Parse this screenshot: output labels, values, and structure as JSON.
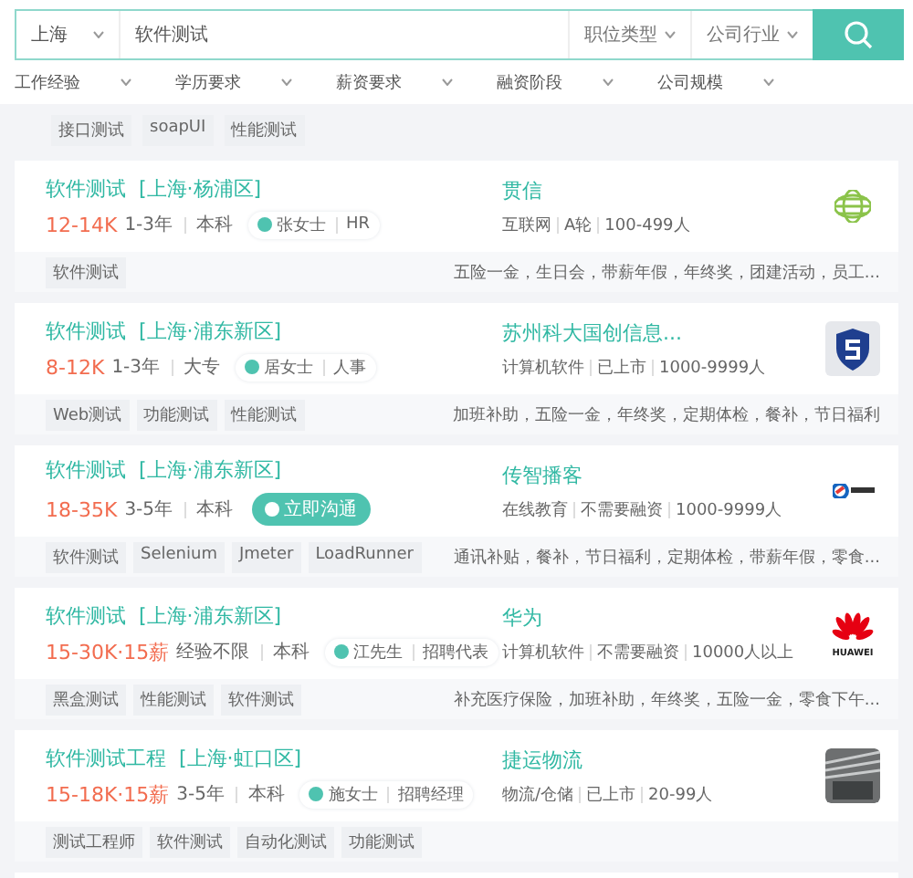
{
  "search": {
    "city": "上海",
    "keyword": "软件测试",
    "dropdowns": [
      "职位类型",
      "公司行业"
    ]
  },
  "filters": [
    "工作经验",
    "学历要求",
    "薪资要求",
    "融资阶段",
    "公司规模"
  ],
  "previous_tags": [
    "接口测试",
    "soapUI",
    "性能测试"
  ],
  "jobs": [
    {
      "title": "软件测试",
      "location": "[上海·杨浦区]",
      "salary": "12-14K",
      "experience": "1-3年",
      "education": "本科",
      "contact": {
        "kind": "recruiter",
        "name": "张女士",
        "role": "HR"
      },
      "company": "贯信",
      "company_info": [
        "互联网",
        "A轮",
        "100-499人"
      ],
      "logo": {
        "kind": "globe"
      },
      "tags": [
        "软件测试"
      ],
      "benefits": "五险一金，生日会，带薪年假，年终奖，团建活动，员工..."
    },
    {
      "title": "软件测试",
      "location": "[上海·浦东新区]",
      "salary": "8-12K",
      "experience": "1-3年",
      "education": "大专",
      "contact": {
        "kind": "recruiter",
        "name": "居女士",
        "role": "人事"
      },
      "company": "苏州科大国创信息...",
      "company_info": [
        "计算机软件",
        "已上市",
        "1000-9999人"
      ],
      "logo": {
        "kind": "shield"
      },
      "tags": [
        "Web测试",
        "功能测试",
        "性能测试"
      ],
      "benefits": "加班补助，五险一金，年终奖，定期体检，餐补，节日福利"
    },
    {
      "title": "软件测试",
      "location": "[上海·浦东新区]",
      "salary": "18-35K",
      "experience": "3-5年",
      "education": "本科",
      "contact": {
        "kind": "chat",
        "label": "立即沟通"
      },
      "company": "传智播客",
      "company_info": [
        "在线教育",
        "不需要融资",
        "1000-9999人"
      ],
      "logo": {
        "kind": "swirl"
      },
      "tags": [
        "软件测试",
        "Selenium",
        "Jmeter",
        "LoadRunner"
      ],
      "benefits": "通讯补贴，餐补，节日福利，定期体检，带薪年假，零食..."
    },
    {
      "title": "软件测试",
      "location": "[上海·浦东新区]",
      "salary": "15-30K·15薪",
      "experience": "经验不限",
      "education": "本科",
      "contact": {
        "kind": "recruiter",
        "name": "江先生",
        "role": "招聘代表"
      },
      "company": "华为",
      "company_info": [
        "计算机软件",
        "不需要融资",
        "10000人以上"
      ],
      "logo": {
        "kind": "petals",
        "text": "HUAWEI"
      },
      "tags": [
        "黑盒测试",
        "性能测试",
        "软件测试"
      ],
      "benefits": "补充医疗保险，加班补助，年终奖，五险一金，零食下午..."
    },
    {
      "title": "软件测试工程",
      "location": "[上海·虹口区]",
      "salary": "15-18K·15薪",
      "experience": "3-5年",
      "education": "本科",
      "contact": {
        "kind": "recruiter",
        "name": "施女士",
        "role": "招聘经理"
      },
      "company": "捷运物流",
      "company_info": [
        "物流/仓储",
        "已上市",
        "20-99人"
      ],
      "logo": {
        "kind": "photo"
      },
      "tags": [
        "测试工程师",
        "软件测试",
        "自动化测试",
        "功能测试"
      ]
    }
  ]
}
